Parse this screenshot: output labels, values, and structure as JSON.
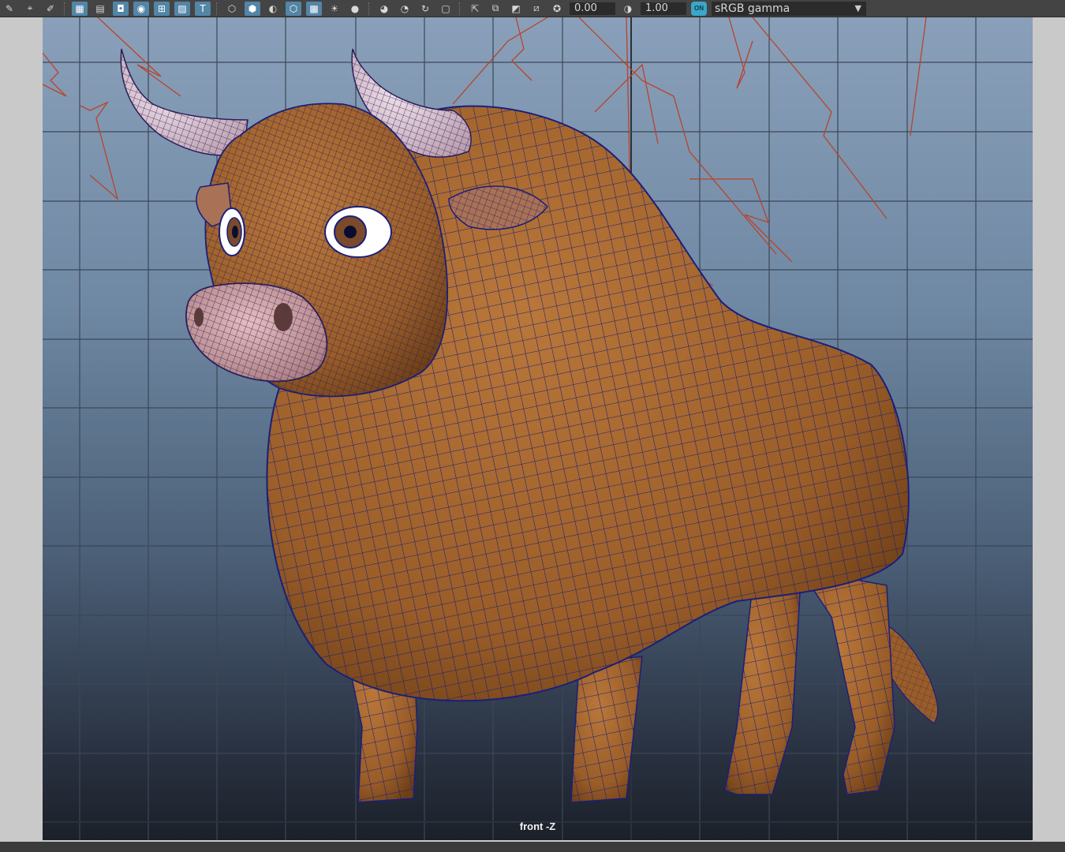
{
  "toolbar": {
    "icons": [
      "bookmark-icon",
      "camera-icon",
      "pen-icon",
      "grid-icon",
      "film-gate-icon",
      "resolution-gate-icon",
      "safe-action-icon",
      "field-chart-icon",
      "image-plane-icon",
      "hud-text-icon",
      "wireframe-cube-icon",
      "smooth-shaded-icon",
      "textured-icon",
      "xray-cube-icon",
      "checker-icon",
      "light-icon",
      "shadow-icon",
      "ambient-occlusion-icon",
      "motion-blur-icon",
      "antialias-icon",
      "isolate-select-icon",
      "xray-joints-icon",
      "xray-active-icon",
      "backface-icon",
      "exposure-icon",
      "gamma-icon",
      "color-management-icon"
    ],
    "exposure_value": "0.00",
    "gamma_value": "1.00",
    "color_management_badge": "ON",
    "color_space": "sRGB gamma"
  },
  "viewport": {
    "camera_label": "front -Z",
    "background_top": "#8aa0ba",
    "background_bottom": "#1b2029",
    "model": "cartoon-bull",
    "model_color": "#a0642e",
    "wire_color": "#1a1f7a",
    "horn_color": "#d9c4cf"
  }
}
